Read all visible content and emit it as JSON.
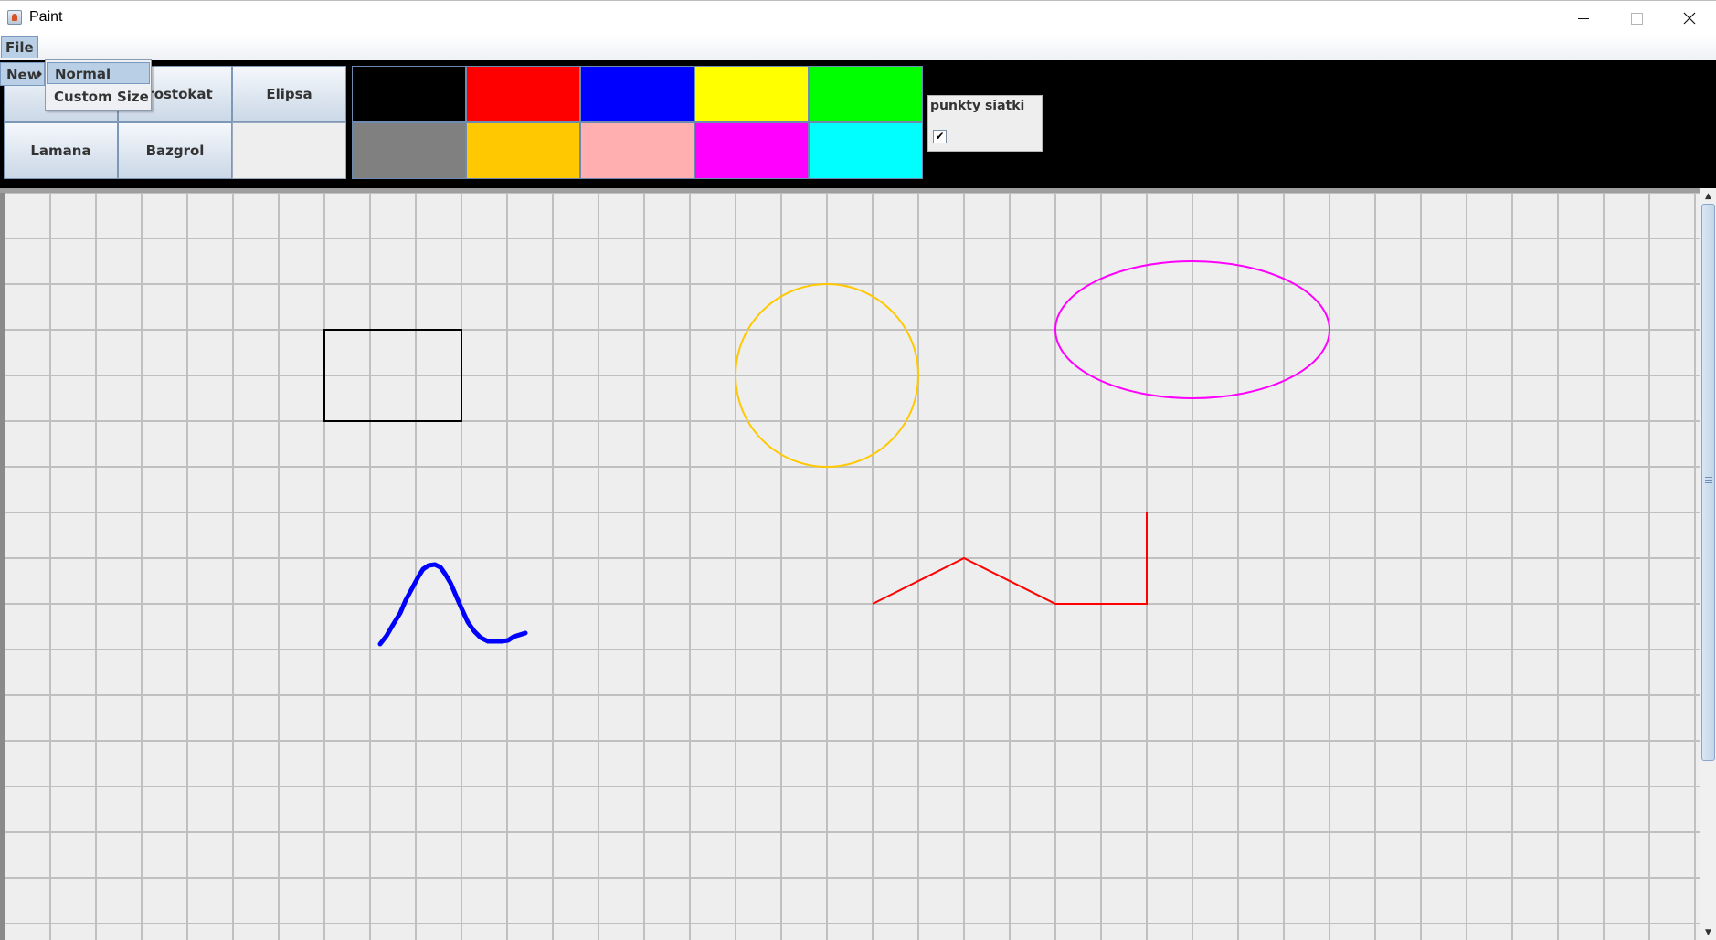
{
  "window": {
    "title": "Paint",
    "app_icon": "java-cup-icon",
    "controls": [
      "minimize-icon",
      "maximize-icon",
      "close-icon"
    ]
  },
  "menubar": {
    "file_label": "File"
  },
  "file_menu": {
    "new_label": "New",
    "new_submenu": {
      "items": [
        {
          "label": "Normal",
          "highlighted": true
        },
        {
          "label": "Custom Size",
          "highlighted": false
        }
      ]
    }
  },
  "toolbar": {
    "tools": [
      {
        "label": "",
        "note": "hidden behind menu"
      },
      {
        "label": "Prostokat"
      },
      {
        "label": "Elipsa"
      },
      {
        "label": "Lamana"
      },
      {
        "label": "Bazgrol"
      }
    ],
    "palette": [
      "#000000",
      "#ff0000",
      "#0000ff",
      "#ffff00",
      "#00ff00",
      "#808080",
      "#ffc800",
      "#ffafaf",
      "#ff00ff",
      "#00ffff"
    ],
    "grid_toggle": {
      "label": "punkty siatki",
      "checked": true
    }
  },
  "canvas": {
    "background": "#eeeeee",
    "grid_color": "#c0c0c0",
    "shapes": [
      {
        "type": "rectangle",
        "stroke": "#000000"
      },
      {
        "type": "circle",
        "stroke": "#ffc800"
      },
      {
        "type": "ellipse",
        "stroke": "#ff00ff"
      },
      {
        "type": "scribble",
        "stroke": "#0000ff"
      },
      {
        "type": "polyline",
        "stroke": "#ff0000"
      }
    ]
  }
}
